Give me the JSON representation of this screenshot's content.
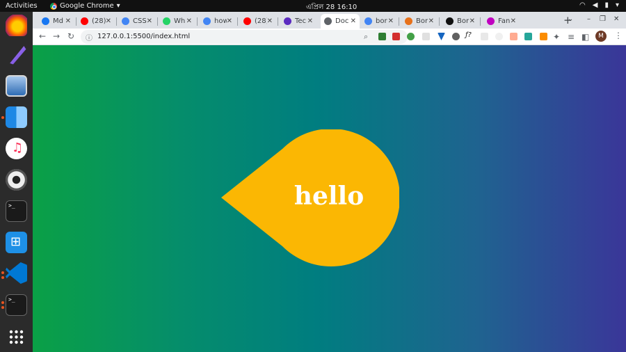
{
  "topbar": {
    "activities": "Activities",
    "app_name": "Google Chrome",
    "clock": "এপ্রিল 28  16:10"
  },
  "dock": {
    "icons": [
      "firefox-icon",
      "feather-icon",
      "image-viewer-icon",
      "finder-icon",
      "music-icon",
      "disk-icon",
      "terminal-icon",
      "windows-icon",
      "vscode-icon",
      "terminal-icon",
      "apps-grid-icon"
    ]
  },
  "tabs": [
    {
      "title": "Md",
      "favicon": "facebook-icon",
      "color": "#1877f2"
    },
    {
      "title": "(28)",
      "favicon": "youtube-icon",
      "color": "#ff0000"
    },
    {
      "title": "CSS",
      "favicon": "dot-icon",
      "color": "#4285f4"
    },
    {
      "title": "Wh",
      "favicon": "whatsapp-icon",
      "color": "#25d366"
    },
    {
      "title": "how",
      "favicon": "google-icon",
      "color": "#4285f4"
    },
    {
      "title": "(28)",
      "favicon": "youtube-icon",
      "color": "#ff0000"
    },
    {
      "title": "Tec",
      "favicon": "tech-icon",
      "color": "#5b2bc0"
    },
    {
      "title": "Doc",
      "favicon": "globe-icon",
      "color": "#5f6368"
    },
    {
      "title": "bor",
      "favicon": "google-icon",
      "color": "#4285f4"
    },
    {
      "title": "Bor",
      "favicon": "colorful-icon",
      "color": "#e7711b"
    },
    {
      "title": "Bor",
      "favicon": "m-icon",
      "color": "#111111"
    },
    {
      "title": "Fan",
      "favicon": "fan-icon",
      "color": "#c000c0"
    }
  ],
  "toolbar": {
    "url": "127.0.0.1:5500/index.html",
    "profile_initial": "M"
  },
  "page": {
    "bubble_text": "hello",
    "bubble_color": "#fbb703",
    "gradient_start": "#0aa046",
    "gradient_end": "#3a3699"
  }
}
